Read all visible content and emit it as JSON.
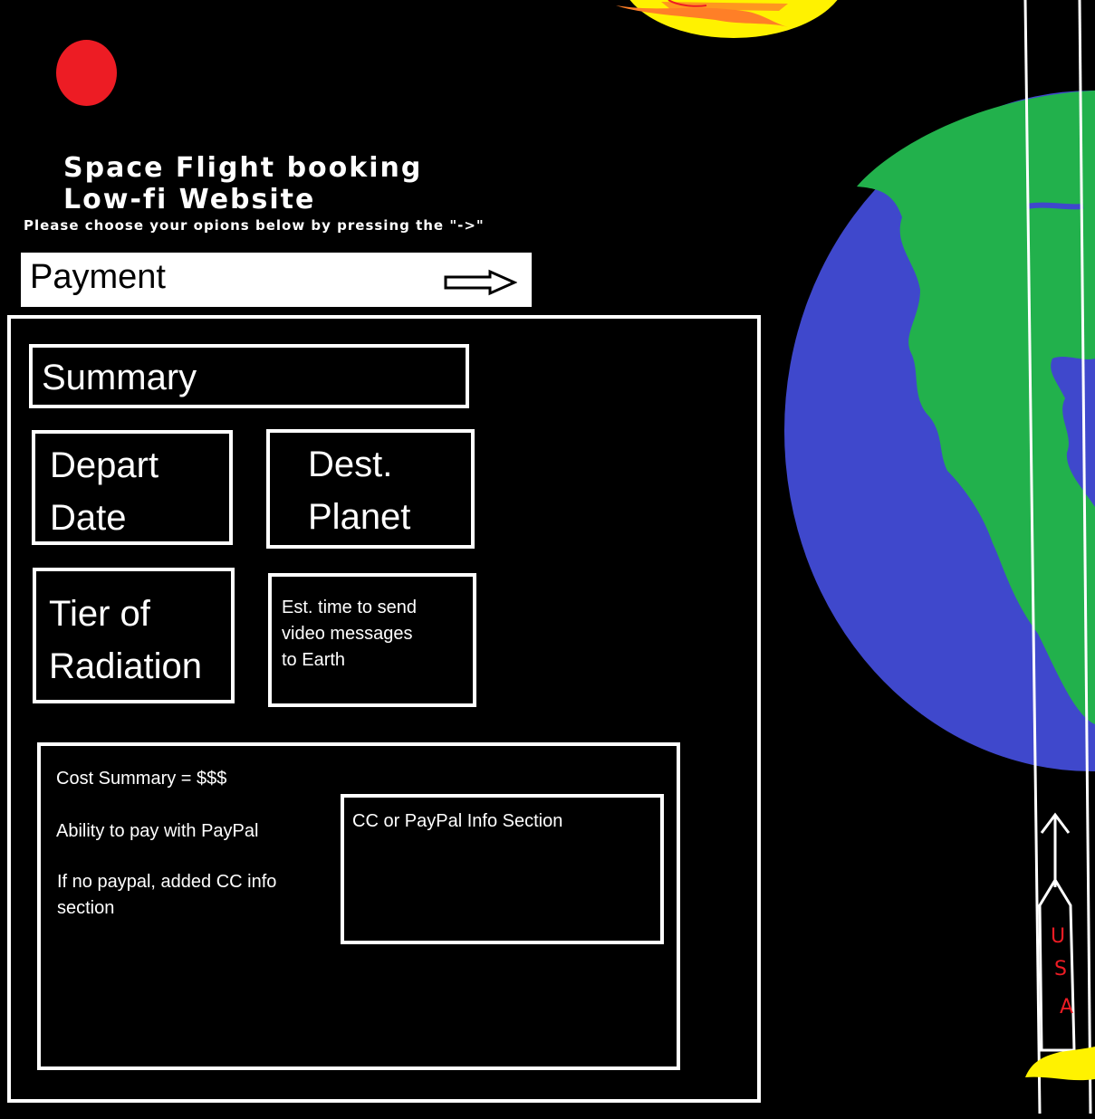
{
  "header": {
    "title_line_1": "Space Flight booking",
    "title_line_2": "Low-fi Website",
    "instruction": "Please choose your opions below by pressing the \"->\""
  },
  "payment_bar": {
    "label": "Payment",
    "arrow_icon": "right-arrow-icon"
  },
  "summary_panel": {
    "summary_label": "Summary",
    "depart_date": {
      "line1": "Depart",
      "line2": "Date"
    },
    "dest_planet": {
      "line1": "Dest.",
      "line2": "Planet"
    },
    "radiation_tier": {
      "line1": "Tier of",
      "line2": "Radiation"
    },
    "video_messages": "Est. time to send\n video messages\nto Earth"
  },
  "cost_panel": {
    "cost_summary": "Cost Summary = $$$",
    "paypal_note": "Ability to pay with PayPal",
    "cc_note": "If no paypal, added CC info\nsection",
    "info_section_label": "CC or PayPal Info Section"
  },
  "rocket": {
    "flag_letters": [
      "U",
      "S",
      "A"
    ]
  },
  "colors": {
    "background": "#000000",
    "foreground": "#ffffff",
    "planet_red": "#ed1c24",
    "earth_ocean": "#3f48cc",
    "earth_land": "#22b14c",
    "sun_yellow": "#fff200",
    "sun_orange": "#ff7f27",
    "rocket_flame": "#fff200",
    "flag_red": "#ed1c24"
  }
}
